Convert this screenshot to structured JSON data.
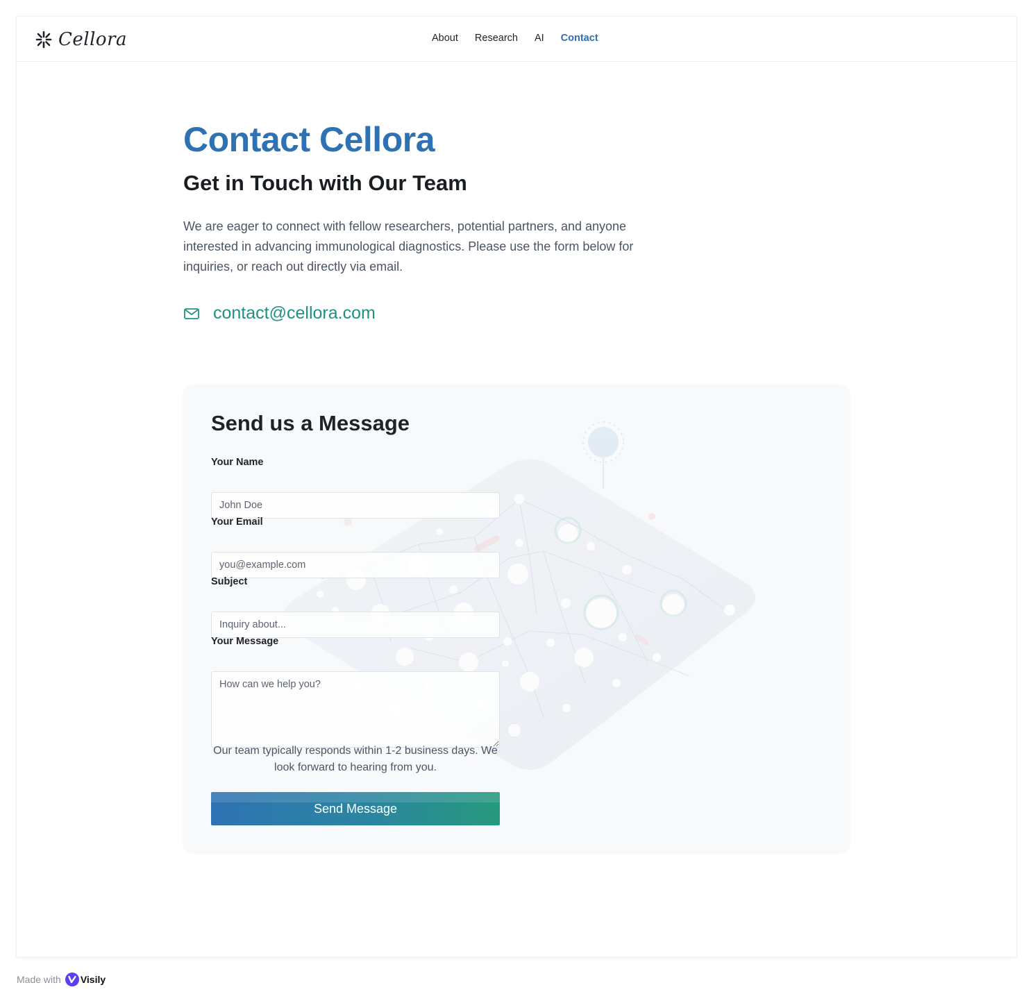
{
  "header": {
    "logo_text": "Cellora",
    "nav": [
      {
        "label": "About",
        "active": false
      },
      {
        "label": "Research",
        "active": false
      },
      {
        "label": "AI",
        "active": false
      },
      {
        "label": "Contact",
        "active": true
      }
    ]
  },
  "hero": {
    "title": "Contact Cellora",
    "subtitle": "Get in Touch with Our Team",
    "intro": "We are eager to connect with fellow researchers, potential partners, and anyone interested in advancing immunological diagnostics. Please use the form below for inquiries, or reach out directly via email.",
    "email": "contact@cellora.com",
    "email_icon": "mail-icon"
  },
  "form": {
    "title": "Send us a Message",
    "fields": {
      "name": {
        "label": "Your Name",
        "placeholder": "John Doe",
        "value": ""
      },
      "email": {
        "label": "Your Email",
        "placeholder": "you@example.com",
        "value": ""
      },
      "subject": {
        "label": "Subject",
        "placeholder": "Inquiry about...",
        "value": ""
      },
      "message": {
        "label": "Your Message",
        "placeholder": "How can we help you?",
        "value": ""
      }
    },
    "note": "Our team typically responds within 1-2 business days. We look forward to hearing from you.",
    "submit_label": "Send Message"
  },
  "footer": {
    "made_with": "Made with",
    "brand": "Visily"
  },
  "colors": {
    "accent_blue": "#2f72b3",
    "accent_teal": "#1f9182",
    "nav_active": "#2f6faf",
    "card_bg": "#f8f9fa"
  }
}
